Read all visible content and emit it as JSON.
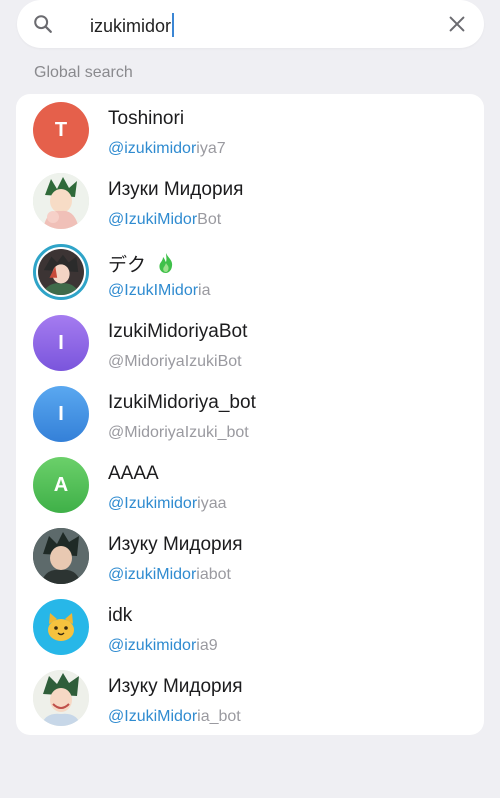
{
  "search": {
    "query": "izukimidor",
    "icon": "search-icon",
    "clear_icon": "close-icon"
  },
  "section": {
    "title": "Global search"
  },
  "accent": "#2f8bd0",
  "results": [
    {
      "name": "Toshinori",
      "handle_prefix": "@",
      "handle_match": "izukimidor",
      "handle_rest": "iya7",
      "avatar_letter": "T",
      "avatar_color": "#e5604b"
    },
    {
      "name": "Изуки Мидория",
      "handle_prefix": "@",
      "handle_match": "IzukiMidor",
      "handle_rest": "Bot",
      "avatar_letter": "",
      "avatar_color": "#dfe7dc"
    },
    {
      "name": "デク",
      "handle_prefix": "@",
      "handle_match": "IzukIMidor",
      "handle_rest": "ia",
      "avatar_letter": "",
      "avatar_color": "#5a4a4a",
      "name_emoji": "fire-emoji"
    },
    {
      "name": "IzukiMidoriyaBot",
      "handle_prefix": "",
      "handle_match": "",
      "handle_rest": "@MidoriyaIzukiBot",
      "avatar_letter": "I",
      "avatar_color": "#8c67e6"
    },
    {
      "name": "IzukiMidoriya_bot",
      "handle_prefix": "",
      "handle_match": "",
      "handle_rest": "@MidoriyaIzuki_bot",
      "avatar_letter": "I",
      "avatar_color": "#3e8fe0"
    },
    {
      "name": "AAAA",
      "handle_prefix": "@",
      "handle_match": "Izukimidor",
      "handle_rest": "iyaa",
      "avatar_letter": "A",
      "avatar_color": "#4cbf52"
    },
    {
      "name": "Изуку Мидория",
      "handle_prefix": "@",
      "handle_match": "izukiMidor",
      "handle_rest": "iabot",
      "avatar_letter": "",
      "avatar_color": "#44504f"
    },
    {
      "name": "idk",
      "handle_prefix": "@",
      "handle_match": "izukimidor",
      "handle_rest": "ia9",
      "avatar_letter": "",
      "avatar_color": "#27b7e8",
      "avatar_icon": "cat-emoji"
    },
    {
      "name": "Изуку Мидория",
      "handle_prefix": "@",
      "handle_match": "IzukiMidor",
      "handle_rest": "ia_bot",
      "avatar_letter": "",
      "avatar_color": "#e9ece6"
    }
  ]
}
